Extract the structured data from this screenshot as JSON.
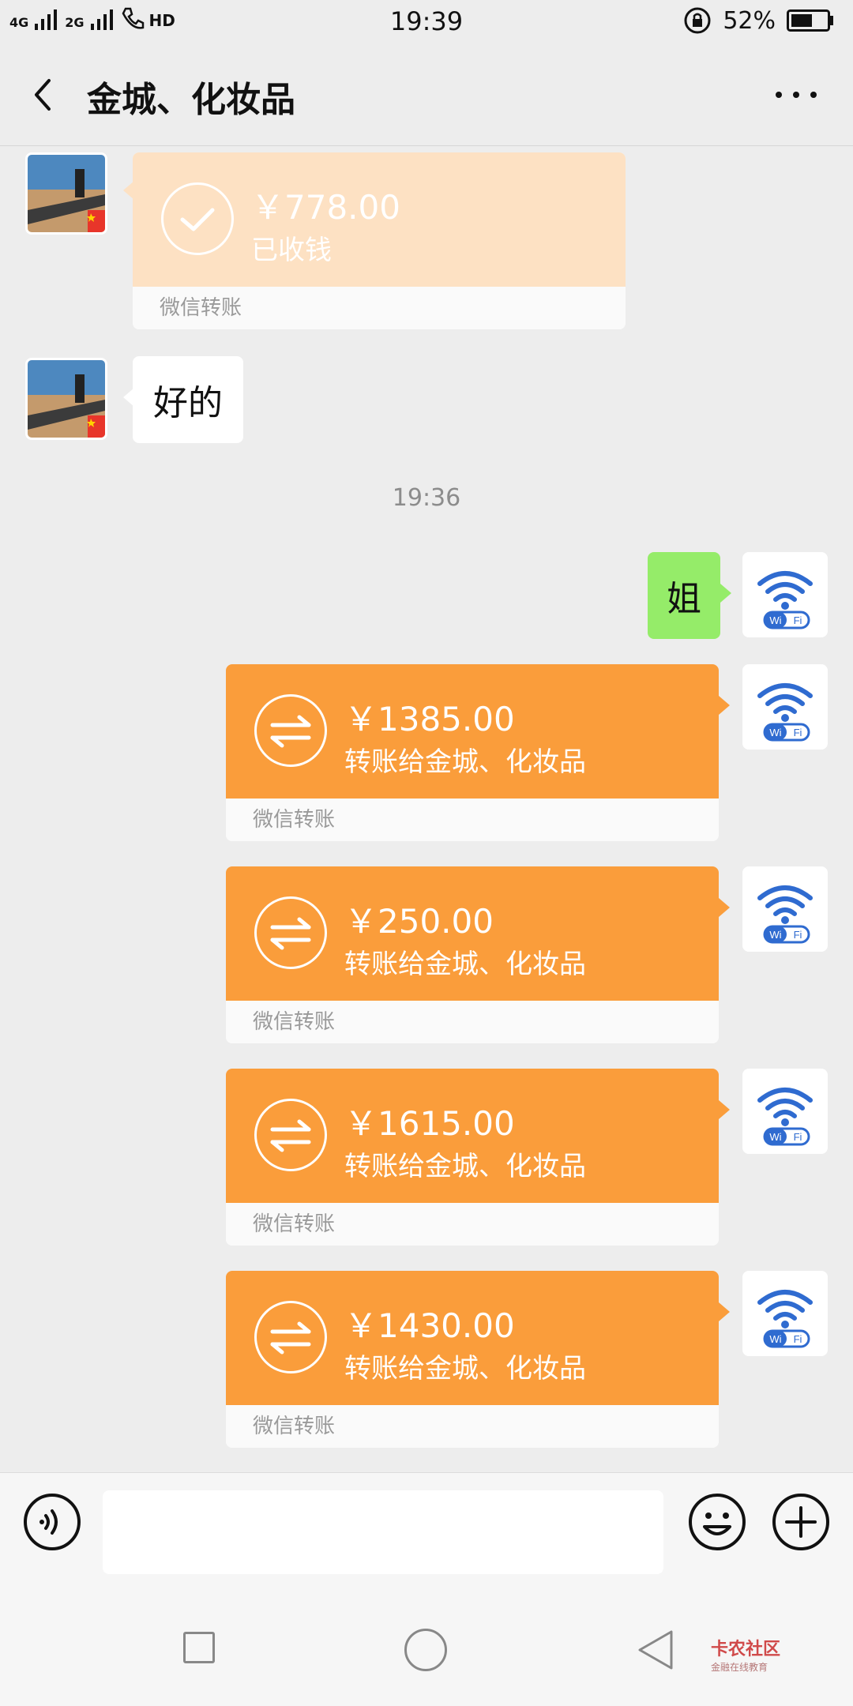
{
  "status_bar": {
    "time": "19:39",
    "network_1": "4G",
    "network_2": "2G",
    "hd": "HD",
    "battery": "52%"
  },
  "header": {
    "title": "金城、化妆品"
  },
  "messages": {
    "received_transfer": {
      "amount": "￥778.00",
      "status": "已收钱",
      "footer": "微信转账"
    },
    "received_text": "好的",
    "timestamp": "19:36",
    "sent_text": "姐",
    "transfers": [
      {
        "amount": "￥1385.00",
        "desc": "转账给金城、化妆品",
        "footer": "微信转账"
      },
      {
        "amount": "￥250.00",
        "desc": "转账给金城、化妆品",
        "footer": "微信转账"
      },
      {
        "amount": "￥1615.00",
        "desc": "转账给金城、化妆品",
        "footer": "微信转账"
      },
      {
        "amount": "￥1430.00",
        "desc": "转账给金城、化妆品",
        "footer": "微信转账"
      }
    ]
  },
  "input_bar": {
    "value": ""
  },
  "watermark": {
    "title": "卡农社区",
    "subtitle": "金融在线教育"
  },
  "colors": {
    "transfer_orange": "#fa9d3b",
    "received_peach": "#fde1c3",
    "sent_green": "#95ec69",
    "background": "#ededed"
  }
}
